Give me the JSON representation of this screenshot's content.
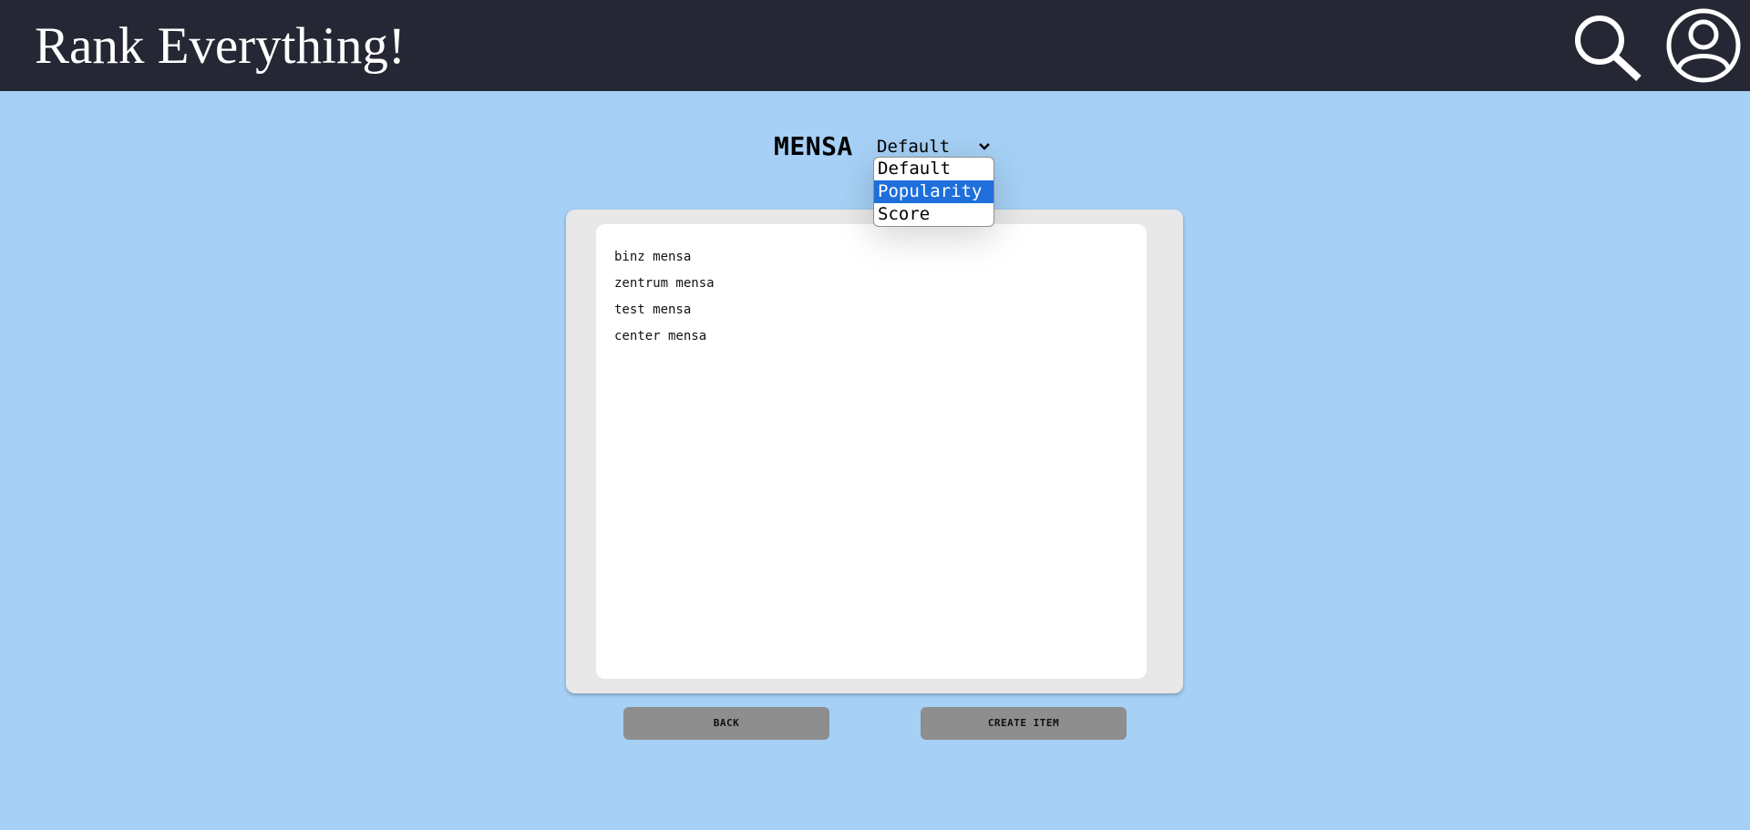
{
  "header": {
    "app_title": "Rank Everything!",
    "search_icon": "search-icon",
    "account_icon": "user-account-icon",
    "background_color": "#262734"
  },
  "category": {
    "title": "MENSA"
  },
  "sort": {
    "selected": "Default",
    "options": [
      "Default",
      "Popularity",
      "Score"
    ],
    "highlighted_option": "Popularity",
    "highlight_color": "#1e6fdb"
  },
  "items": [
    {
      "name": "binz mensa"
    },
    {
      "name": "zentrum mensa"
    },
    {
      "name": "test mensa"
    },
    {
      "name": "center mensa"
    }
  ],
  "actions": {
    "back_label": "BACK",
    "create_label": "CREATE ITEM"
  },
  "theme": {
    "page_background": "#a6d0f5",
    "button_color": "#8e8e8e"
  }
}
